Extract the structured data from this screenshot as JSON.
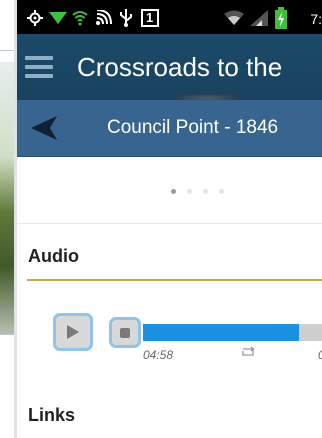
{
  "status_bar": {
    "icons": [
      "gps-icon",
      "wifi-triangle-icon",
      "wifi-icon",
      "nfc-icon",
      "usb-icon",
      "notification-1-icon",
      "wifi-signal-icon",
      "cell-signal-icon",
      "battery-charging-icon"
    ],
    "notification_number": "1",
    "time": "7:"
  },
  "action_bar": {
    "title": "Crossroads to the",
    "menu_icon": "hamburger-menu-icon"
  },
  "sub_bar": {
    "title": "Council Point - 1846",
    "back_icon": "back-arrow-icon"
  },
  "pager": {
    "count": 4,
    "active_index": 0
  },
  "audio": {
    "heading": "Audio",
    "elapsed": "04:58",
    "remaining": "0",
    "progress_fraction": 0.87,
    "play_icon": "play-icon",
    "stop_icon": "stop-icon",
    "repeat_icon": "repeat-icon"
  },
  "links": {
    "heading": "Links"
  },
  "colors": {
    "action_bar": "#1c4a6a",
    "sub_bar": "#37658f",
    "accent_rule": "#c9a453",
    "progress": "#1a90e0",
    "button_border": "#8fc3ea"
  }
}
